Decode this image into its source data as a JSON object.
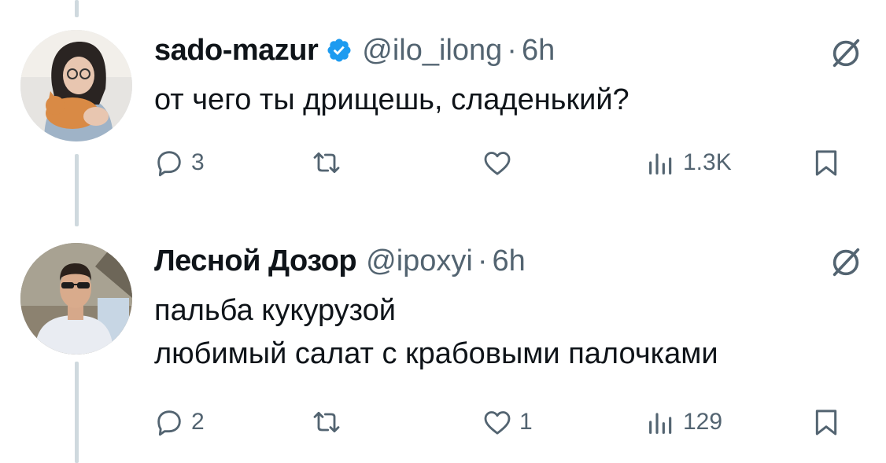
{
  "tweets": [
    {
      "author_name": "sado-mazur",
      "verified": true,
      "handle": "@ilo_ilong",
      "separator": "·",
      "time": "6h",
      "lines": [
        "от чего ты дрищешь, сладенький?"
      ],
      "replies": "3",
      "retweets": "",
      "likes": "",
      "views": "1.3K",
      "avatar_icon": "avatar-woman-with-cat"
    },
    {
      "author_name": "Лесной Дозор",
      "verified": false,
      "handle": "@ipoxyi",
      "separator": "·",
      "time": "6h",
      "lines": [
        "пальба кукурузой",
        "любимый салат с крабовыми палочками"
      ],
      "replies": "2",
      "retweets": "",
      "likes": "1",
      "views": "129",
      "avatar_icon": "avatar-man-with-sunglasses"
    }
  ],
  "colors": {
    "text": "#0f1419",
    "secondary": "#536471",
    "verified_blue": "#1d9bf0",
    "thread_line": "#cfd9de"
  }
}
